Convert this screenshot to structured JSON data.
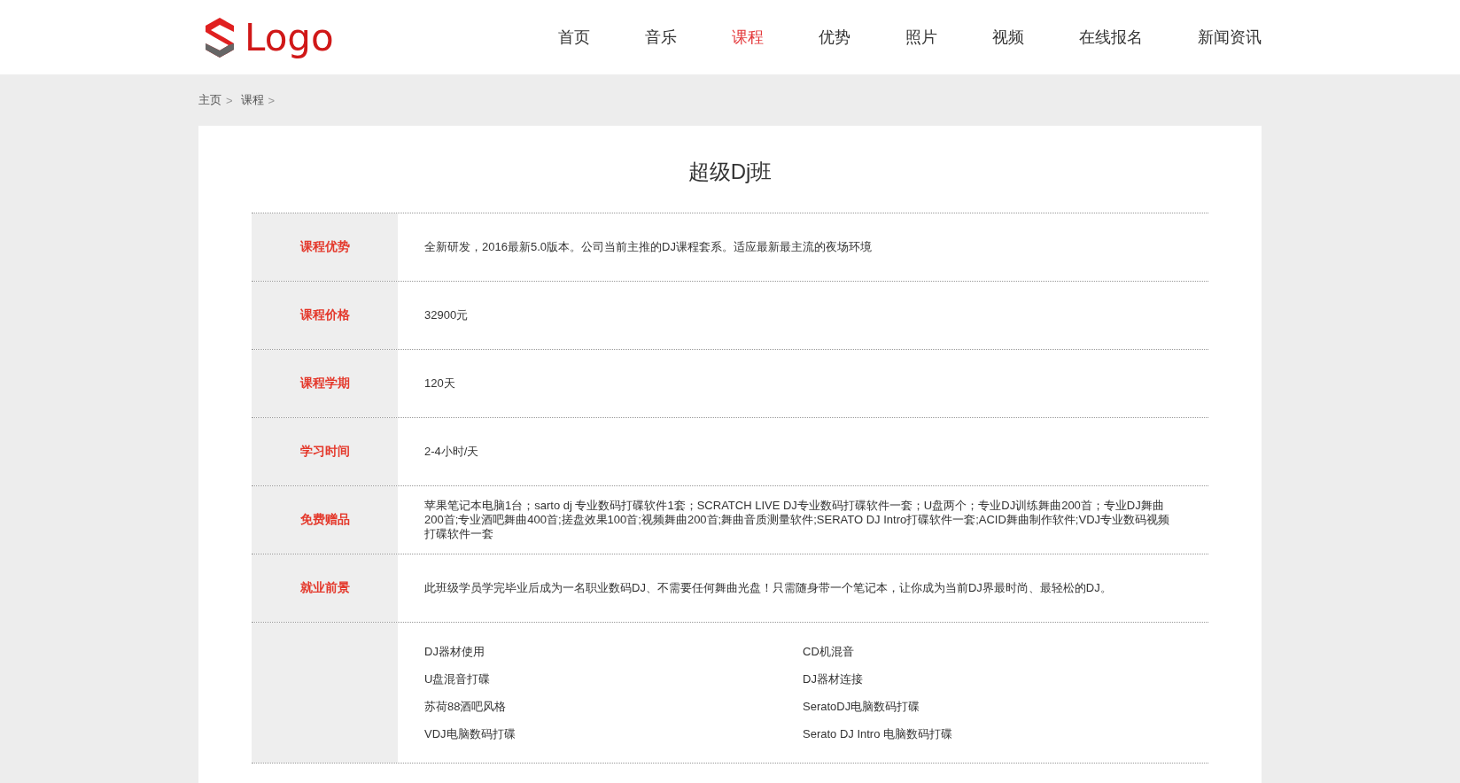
{
  "header": {
    "logo_text": "Logo",
    "nav": [
      {
        "label": "首页",
        "selected": false
      },
      {
        "label": "音乐",
        "selected": false
      },
      {
        "label": "课程",
        "selected": true
      },
      {
        "label": "优势",
        "selected": false
      },
      {
        "label": "照片",
        "selected": false
      },
      {
        "label": "视频",
        "selected": false
      },
      {
        "label": "在线报名",
        "selected": false
      },
      {
        "label": "新闻资讯",
        "selected": false
      }
    ]
  },
  "breadcrumb": [
    {
      "label": "主页",
      "separator": ">"
    },
    {
      "label": "课程",
      "separator": ">"
    }
  ],
  "course": {
    "title": "超级Dj班",
    "rows": [
      {
        "kind": "text",
        "label": "课程优势",
        "value": "全新研发，2016最新5.0版本。公司当前主推的DJ课程套系。适应最新最主流的夜场环境"
      },
      {
        "kind": "text",
        "label": "课程价格",
        "value": "32900元"
      },
      {
        "kind": "text",
        "label": "课程学期",
        "value": "120天"
      },
      {
        "kind": "text",
        "label": "学习时间",
        "value": "2-4小时/天"
      },
      {
        "kind": "text",
        "label": "免费赠品",
        "value": "苹果笔记本电脑1台；sarto dj 专业数码打碟软件1套；SCRATCH LIVE DJ专业数码打碟软件一套；U盘两个；专业DJ训练舞曲200首；专业DJ舞曲200首;专业酒吧舞曲400首;搓盘效果100首;视频舞曲200首;舞曲音质测量软件;SERATO DJ Intro打碟软件一套;ACID舞曲制作软件;VDJ专业数码视频打碟软件一套"
      },
      {
        "kind": "text",
        "label": "就业前景",
        "value": "此班级学员学完毕业后成为一名职业数码DJ、不需要任何舞曲光盘！只需随身带一个笔记本，让你成为当前DJ界最时尚、最轻松的DJ。"
      },
      {
        "kind": "list",
        "items": [
          "DJ器材使用",
          "CD机混音",
          "U盘混音打碟",
          "DJ器材连接",
          "苏荷88酒吧风格",
          "SeratoDJ电脑数码打碟",
          "VDJ电脑数码打碟",
          "Serato DJ Intro 电脑数码打碟"
        ]
      }
    ]
  }
}
